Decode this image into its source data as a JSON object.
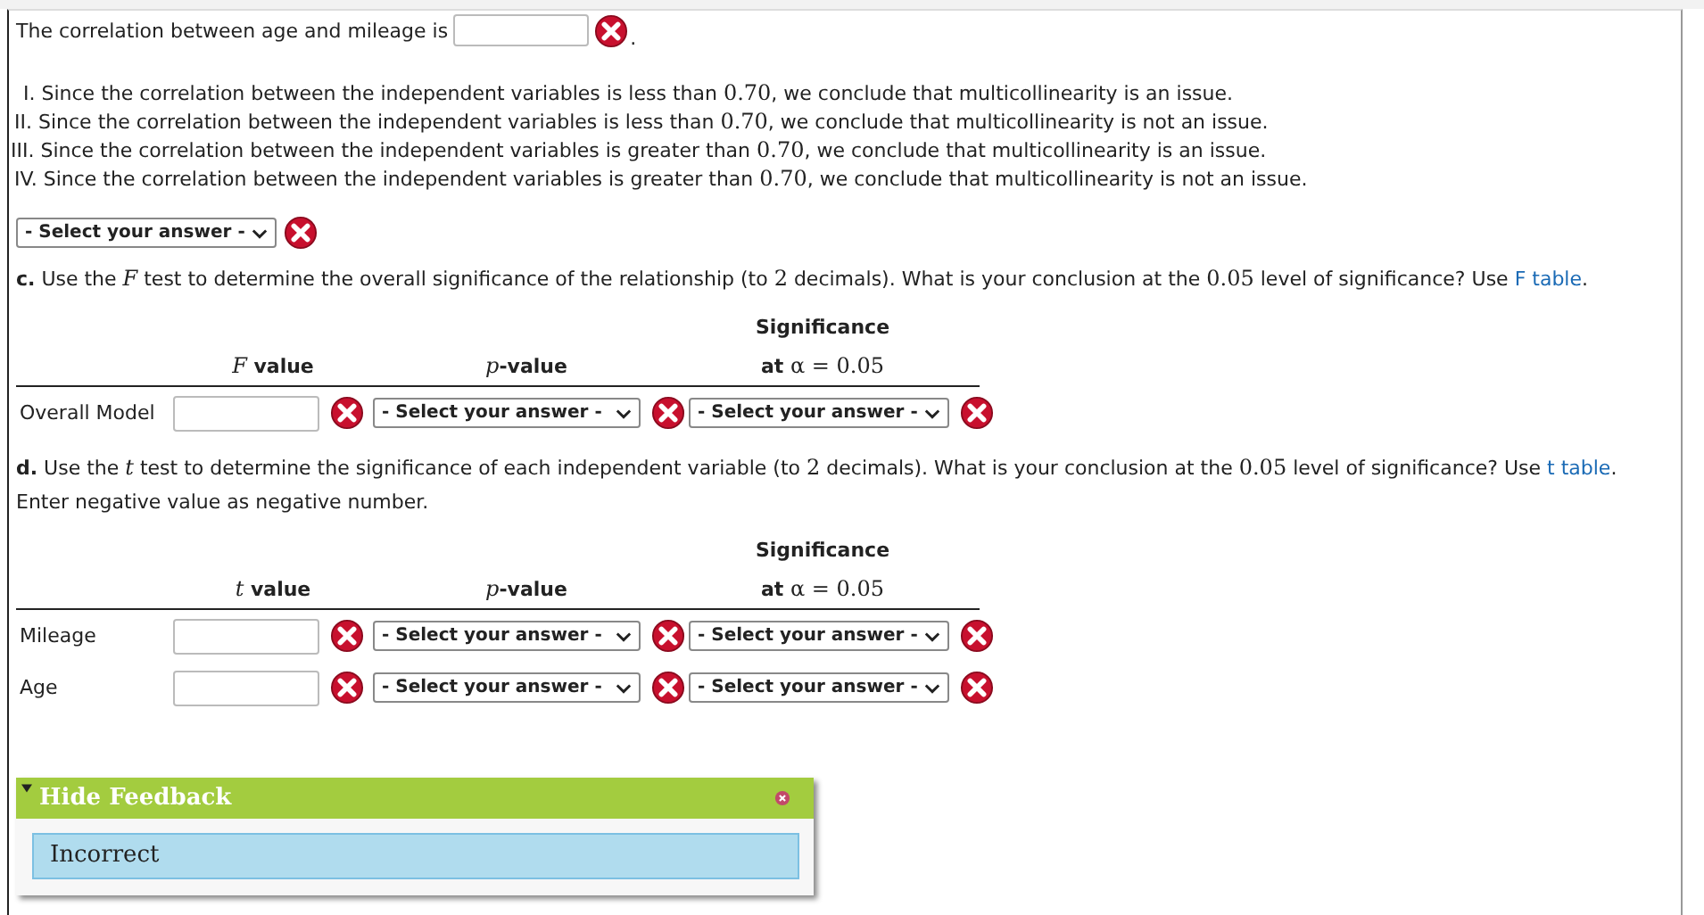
{
  "correlation": {
    "label": "The correlation between age and mileage is",
    "correct": false,
    "suffix": "."
  },
  "statements": [
    {
      "numeral": "I.",
      "parts": [
        {
          "kind": "plain",
          "text": "Since the correlation between the independent variables is less than "
        },
        {
          "kind": "math",
          "text": "0.70"
        },
        {
          "kind": "plain",
          "text": ", we conclude that multicollinearity is an issue."
        }
      ]
    },
    {
      "numeral": "II.",
      "parts": [
        {
          "kind": "plain",
          "text": "Since the correlation between the independent variables is less than "
        },
        {
          "kind": "math",
          "text": "0.70"
        },
        {
          "kind": "plain",
          "text": ", we conclude that multicollinearity is not an issue."
        }
      ]
    },
    {
      "numeral": "III.",
      "parts": [
        {
          "kind": "plain",
          "text": "Since the correlation between the independent variables is greater than "
        },
        {
          "kind": "math",
          "text": "0.70"
        },
        {
          "kind": "plain",
          "text": ", we conclude that multicollinearity is an issue."
        }
      ]
    },
    {
      "numeral": "IV.",
      "parts": [
        {
          "kind": "plain",
          "text": "Since the correlation between the independent variables is greater than "
        },
        {
          "kind": "math",
          "text": "0.70"
        },
        {
          "kind": "plain",
          "text": ", we conclude that multicollinearity is not an issue."
        }
      ]
    }
  ],
  "statement_answer": {
    "text": "- Select your answer -",
    "correct": false
  },
  "part_c": {
    "question": [
      {
        "kind": "bold",
        "text": "c."
      },
      {
        "kind": "plain",
        "text": " Use the "
      },
      {
        "kind": "var",
        "text": "F"
      },
      {
        "kind": "plain",
        "text": " test to determine the overall significance of the relationship (to "
      },
      {
        "kind": "math",
        "text": "2"
      },
      {
        "kind": "plain",
        "text": " decimals). What is your conclusion at the "
      },
      {
        "kind": "math",
        "text": "0.05"
      },
      {
        "kind": "plain",
        "text": " level of significance? Use "
      },
      {
        "kind": "link",
        "text": "F table"
      },
      {
        "kind": "plain",
        "text": "."
      }
    ],
    "table": {
      "headers": [
        [
          {
            "kind": "var",
            "text": "F"
          },
          {
            "kind": "bold",
            "text": " value"
          }
        ],
        [
          {
            "kind": "var",
            "text": "p"
          },
          {
            "kind": "bold",
            "text": "-value"
          }
        ],
        [
          {
            "kind": "bold",
            "text": "at "
          },
          {
            "kind": "math",
            "text": "α = 0.05"
          }
        ]
      ],
      "header_top": "Significance",
      "rows": [
        {
          "label": "Overall Model",
          "value_correct": false,
          "pvalue": {
            "text": "- Select your answer -",
            "correct": false
          },
          "significance": {
            "text": "- Select your answer -",
            "correct": false
          }
        }
      ]
    }
  },
  "part_d": {
    "question": [
      {
        "kind": "bold",
        "text": "d."
      },
      {
        "kind": "plain",
        "text": " Use the "
      },
      {
        "kind": "var",
        "text": "t"
      },
      {
        "kind": "plain",
        "text": " test to determine the significance of each independent variable (to "
      },
      {
        "kind": "math",
        "text": "2"
      },
      {
        "kind": "plain",
        "text": " decimals). What is your conclusion at the "
      },
      {
        "kind": "math",
        "text": "0.05"
      },
      {
        "kind": "plain",
        "text": " level of significance? Use "
      },
      {
        "kind": "link",
        "text": "t table"
      },
      {
        "kind": "plain",
        "text": ". Enter negative value as negative number."
      }
    ],
    "table": {
      "headers": [
        [
          {
            "kind": "var",
            "text": "t"
          },
          {
            "kind": "bold",
            "text": " value"
          }
        ],
        [
          {
            "kind": "var",
            "text": "p"
          },
          {
            "kind": "bold",
            "text": "-value"
          }
        ],
        [
          {
            "kind": "bold",
            "text": "at "
          },
          {
            "kind": "math",
            "text": "α = 0.05"
          }
        ]
      ],
      "header_top": "Significance",
      "rows": [
        {
          "label": "Mileage",
          "value_correct": false,
          "pvalue": {
            "text": "- Select your answer -",
            "correct": false
          },
          "significance": {
            "text": "- Select your answer -",
            "correct": false
          }
        },
        {
          "label": "Age",
          "value_correct": false,
          "pvalue": {
            "text": "- Select your answer -",
            "correct": false
          },
          "significance": {
            "text": "- Select your answer -",
            "correct": false
          }
        }
      ]
    }
  },
  "feedback": {
    "title": "Hide Feedback",
    "expanded": true,
    "message": "Incorrect"
  }
}
